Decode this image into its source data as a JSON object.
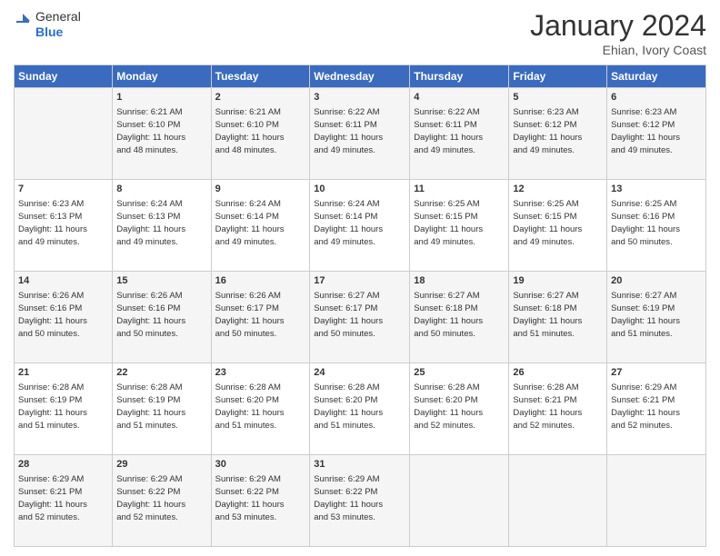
{
  "header": {
    "logo_line1": "General",
    "logo_line2": "Blue",
    "month_title": "January 2024",
    "location": "Ehian, Ivory Coast"
  },
  "days_of_week": [
    "Sunday",
    "Monday",
    "Tuesday",
    "Wednesday",
    "Thursday",
    "Friday",
    "Saturday"
  ],
  "weeks": [
    [
      {
        "num": "",
        "info": ""
      },
      {
        "num": "1",
        "info": "Sunrise: 6:21 AM\nSunset: 6:10 PM\nDaylight: 11 hours\nand 48 minutes."
      },
      {
        "num": "2",
        "info": "Sunrise: 6:21 AM\nSunset: 6:10 PM\nDaylight: 11 hours\nand 48 minutes."
      },
      {
        "num": "3",
        "info": "Sunrise: 6:22 AM\nSunset: 6:11 PM\nDaylight: 11 hours\nand 49 minutes."
      },
      {
        "num": "4",
        "info": "Sunrise: 6:22 AM\nSunset: 6:11 PM\nDaylight: 11 hours\nand 49 minutes."
      },
      {
        "num": "5",
        "info": "Sunrise: 6:23 AM\nSunset: 6:12 PM\nDaylight: 11 hours\nand 49 minutes."
      },
      {
        "num": "6",
        "info": "Sunrise: 6:23 AM\nSunset: 6:12 PM\nDaylight: 11 hours\nand 49 minutes."
      }
    ],
    [
      {
        "num": "7",
        "info": "Sunrise: 6:23 AM\nSunset: 6:13 PM\nDaylight: 11 hours\nand 49 minutes."
      },
      {
        "num": "8",
        "info": "Sunrise: 6:24 AM\nSunset: 6:13 PM\nDaylight: 11 hours\nand 49 minutes."
      },
      {
        "num": "9",
        "info": "Sunrise: 6:24 AM\nSunset: 6:14 PM\nDaylight: 11 hours\nand 49 minutes."
      },
      {
        "num": "10",
        "info": "Sunrise: 6:24 AM\nSunset: 6:14 PM\nDaylight: 11 hours\nand 49 minutes."
      },
      {
        "num": "11",
        "info": "Sunrise: 6:25 AM\nSunset: 6:15 PM\nDaylight: 11 hours\nand 49 minutes."
      },
      {
        "num": "12",
        "info": "Sunrise: 6:25 AM\nSunset: 6:15 PM\nDaylight: 11 hours\nand 49 minutes."
      },
      {
        "num": "13",
        "info": "Sunrise: 6:25 AM\nSunset: 6:16 PM\nDaylight: 11 hours\nand 50 minutes."
      }
    ],
    [
      {
        "num": "14",
        "info": "Sunrise: 6:26 AM\nSunset: 6:16 PM\nDaylight: 11 hours\nand 50 minutes."
      },
      {
        "num": "15",
        "info": "Sunrise: 6:26 AM\nSunset: 6:16 PM\nDaylight: 11 hours\nand 50 minutes."
      },
      {
        "num": "16",
        "info": "Sunrise: 6:26 AM\nSunset: 6:17 PM\nDaylight: 11 hours\nand 50 minutes."
      },
      {
        "num": "17",
        "info": "Sunrise: 6:27 AM\nSunset: 6:17 PM\nDaylight: 11 hours\nand 50 minutes."
      },
      {
        "num": "18",
        "info": "Sunrise: 6:27 AM\nSunset: 6:18 PM\nDaylight: 11 hours\nand 50 minutes."
      },
      {
        "num": "19",
        "info": "Sunrise: 6:27 AM\nSunset: 6:18 PM\nDaylight: 11 hours\nand 51 minutes."
      },
      {
        "num": "20",
        "info": "Sunrise: 6:27 AM\nSunset: 6:19 PM\nDaylight: 11 hours\nand 51 minutes."
      }
    ],
    [
      {
        "num": "21",
        "info": "Sunrise: 6:28 AM\nSunset: 6:19 PM\nDaylight: 11 hours\nand 51 minutes."
      },
      {
        "num": "22",
        "info": "Sunrise: 6:28 AM\nSunset: 6:19 PM\nDaylight: 11 hours\nand 51 minutes."
      },
      {
        "num": "23",
        "info": "Sunrise: 6:28 AM\nSunset: 6:20 PM\nDaylight: 11 hours\nand 51 minutes."
      },
      {
        "num": "24",
        "info": "Sunrise: 6:28 AM\nSunset: 6:20 PM\nDaylight: 11 hours\nand 51 minutes."
      },
      {
        "num": "25",
        "info": "Sunrise: 6:28 AM\nSunset: 6:20 PM\nDaylight: 11 hours\nand 52 minutes."
      },
      {
        "num": "26",
        "info": "Sunrise: 6:28 AM\nSunset: 6:21 PM\nDaylight: 11 hours\nand 52 minutes."
      },
      {
        "num": "27",
        "info": "Sunrise: 6:29 AM\nSunset: 6:21 PM\nDaylight: 11 hours\nand 52 minutes."
      }
    ],
    [
      {
        "num": "28",
        "info": "Sunrise: 6:29 AM\nSunset: 6:21 PM\nDaylight: 11 hours\nand 52 minutes."
      },
      {
        "num": "29",
        "info": "Sunrise: 6:29 AM\nSunset: 6:22 PM\nDaylight: 11 hours\nand 52 minutes."
      },
      {
        "num": "30",
        "info": "Sunrise: 6:29 AM\nSunset: 6:22 PM\nDaylight: 11 hours\nand 53 minutes."
      },
      {
        "num": "31",
        "info": "Sunrise: 6:29 AM\nSunset: 6:22 PM\nDaylight: 11 hours\nand 53 minutes."
      },
      {
        "num": "",
        "info": ""
      },
      {
        "num": "",
        "info": ""
      },
      {
        "num": "",
        "info": ""
      }
    ]
  ]
}
